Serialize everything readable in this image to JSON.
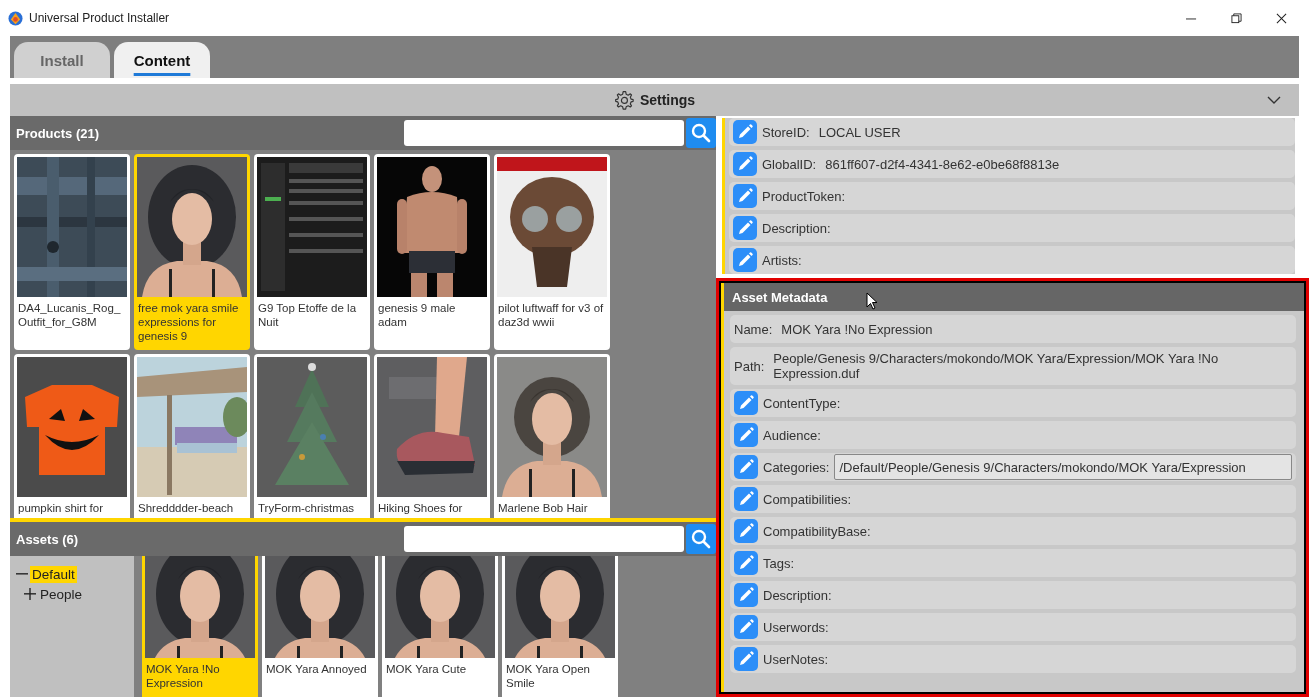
{
  "window": {
    "title": "Universal Product Installer"
  },
  "tabs": [
    {
      "label": "Install",
      "selected": false
    },
    {
      "label": "Content",
      "selected": true
    }
  ],
  "settings_bar": {
    "label": "Settings",
    "expanded": false
  },
  "products": {
    "title": "Products (21)",
    "items": [
      {
        "label": "DA4_Lucanis_Rog_Outfit_for_G8M",
        "selected": false
      },
      {
        "label": "free mok yara smile expressions for genesis 9",
        "selected": true
      },
      {
        "label": "G9 Top Etoffe de la Nuit",
        "selected": false
      },
      {
        "label": "genesis 9 male adam",
        "selected": false
      },
      {
        "label": "pilot luftwaff for v3 of daz3d wwii",
        "selected": false
      },
      {
        "label": "pumpkin shirt for",
        "selected": false
      },
      {
        "label": "Shredddder-beach",
        "selected": false
      },
      {
        "label": "TryForm-christmas",
        "selected": false
      },
      {
        "label": "Hiking Shoes for",
        "selected": false
      },
      {
        "label": "Marlene Bob Hair",
        "selected": false
      }
    ]
  },
  "assets": {
    "title": "Assets (6)",
    "tree": [
      {
        "label": "Default",
        "expanded": true,
        "selected": true,
        "children": [
          {
            "label": "People",
            "expanded": false,
            "selected": false
          }
        ]
      }
    ],
    "items": [
      {
        "label": "MOK Yara !No Expression",
        "selected": true
      },
      {
        "label": "MOK Yara Annoyed",
        "selected": false
      },
      {
        "label": "MOK Yara Cute",
        "selected": false
      },
      {
        "label": "MOK Yara Open Smile",
        "selected": false
      }
    ]
  },
  "product_metadata": {
    "rows": [
      {
        "kind": "edit",
        "label": "StoreID:",
        "value": "LOCAL USER"
      },
      {
        "kind": "edit",
        "label": "GlobalID:",
        "value": "861ff607-d2f4-4341-8e62-e0be68f8813e"
      },
      {
        "kind": "edit",
        "label": "ProductToken:"
      },
      {
        "kind": "edit",
        "label": "Description:"
      },
      {
        "kind": "edit",
        "label": "Artists:"
      }
    ]
  },
  "asset_metadata": {
    "title": "Asset Metadata",
    "highlighted": true,
    "rows": [
      {
        "kind": "plain",
        "label": "Name:",
        "value": "MOK Yara !No Expression"
      },
      {
        "kind": "plain",
        "label": "Path:",
        "value": "People/Genesis 9/Characters/mokondo/MOK Yara/Expression/MOK Yara !No Expression.duf"
      },
      {
        "kind": "edit",
        "label": "ContentType:"
      },
      {
        "kind": "edit",
        "label": "Audience:"
      },
      {
        "kind": "field",
        "label": "Categories:",
        "value": "/Default/People/Genesis 9/Characters/mokondo/MOK Yara/Expression"
      },
      {
        "kind": "edit",
        "label": "Compatibilities:"
      },
      {
        "kind": "edit",
        "label": "CompatibilityBase:"
      },
      {
        "kind": "edit",
        "label": "Tags:"
      },
      {
        "kind": "edit",
        "label": "Description:"
      },
      {
        "kind": "edit",
        "label": "Userwords:"
      },
      {
        "kind": "edit",
        "label": "UserNotes:"
      }
    ]
  }
}
